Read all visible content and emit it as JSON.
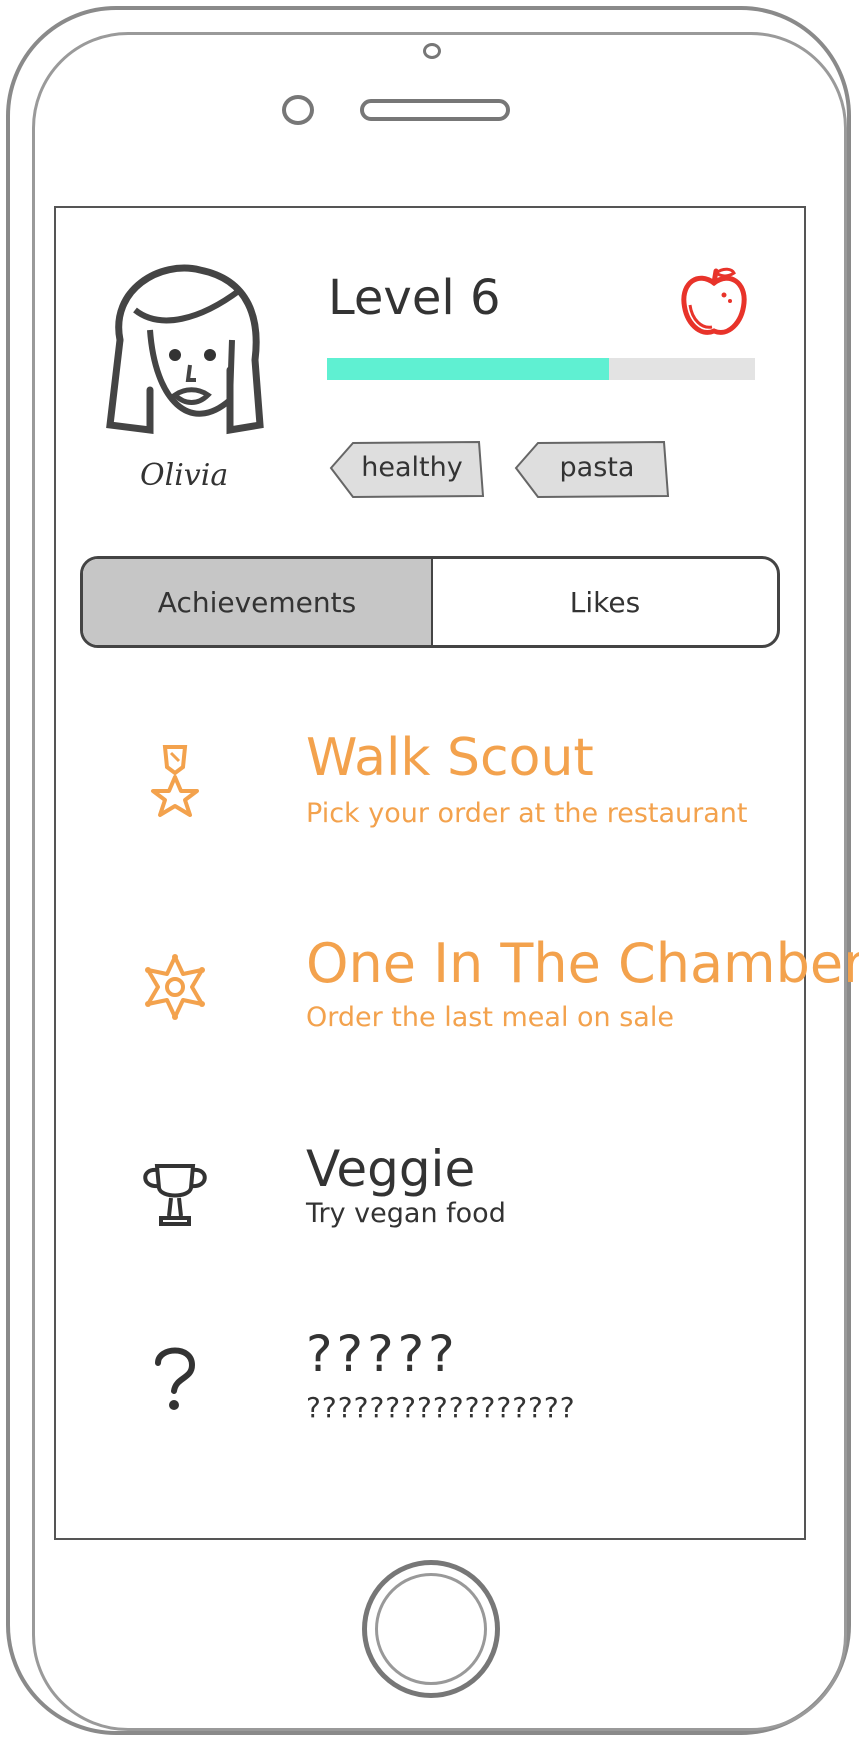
{
  "profile": {
    "name": "Olivia",
    "level_label": "Level 6",
    "progress": 0.66,
    "tags": [
      "healthy",
      "pasta"
    ],
    "progress_color": "#5ff0d2"
  },
  "tabs": [
    {
      "label": "Achievements",
      "active": true
    },
    {
      "label": "Likes",
      "active": false
    }
  ],
  "achievements": [
    {
      "title": "Walk Scout",
      "description": "Pick your order at the restaurant",
      "icon": "medal-star-icon",
      "unlocked": true
    },
    {
      "title": "One In The Chamber",
      "description": "Order the last meal on sale",
      "icon": "sheriff-badge-icon",
      "unlocked": true
    },
    {
      "title": "Veggie",
      "description": "Try vegan food",
      "icon": "trophy-icon",
      "unlocked": false
    },
    {
      "title": "?????",
      "description": "?????????????????",
      "icon": "question-mark-icon",
      "unlocked": false
    }
  ],
  "colors": {
    "unlocked": "#f3a24d",
    "locked": "#333333",
    "apple": "#e8332a",
    "active_tab": "#c6c6c6"
  }
}
